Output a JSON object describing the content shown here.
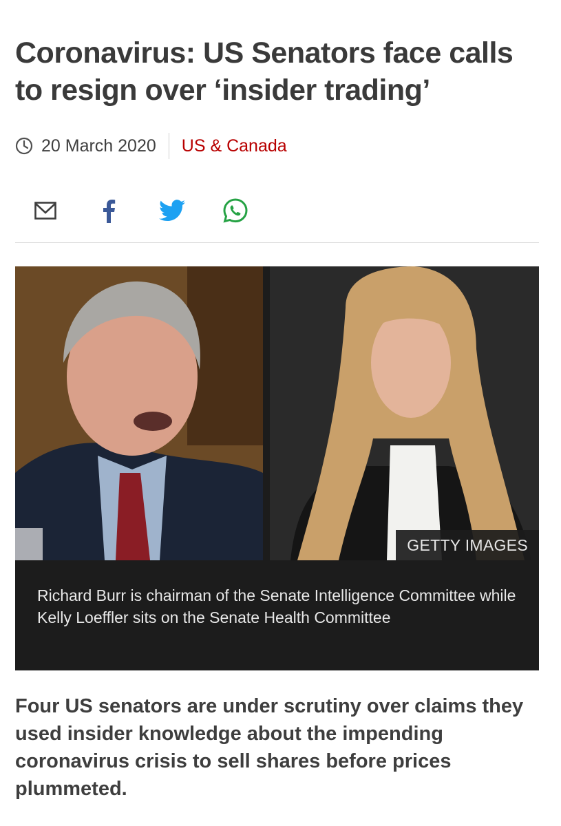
{
  "article": {
    "headline": "Coronavirus: US Senators face calls to resign over ‘insider trading’",
    "date": "20 March 2020",
    "section": "US & Canada",
    "section_color": "#b80000",
    "image_credit": "GETTY IMAGES",
    "image_caption": "Richard Burr is chairman of the Senate Intelligence Committee while Kelly Loeffler sits on the Senate Health Committee",
    "intro": "Four US senators are under scrutiny over claims they used insider knowledge about the impending coronavirus crisis to sell shares before prices plummeted."
  },
  "share": {
    "icons": [
      "email-icon",
      "facebook-icon",
      "twitter-icon",
      "whatsapp-icon"
    ],
    "colors": {
      "email": "#3e3e3e",
      "facebook": "#3b5998",
      "twitter": "#1da1f2",
      "whatsapp": "#25a244"
    }
  }
}
